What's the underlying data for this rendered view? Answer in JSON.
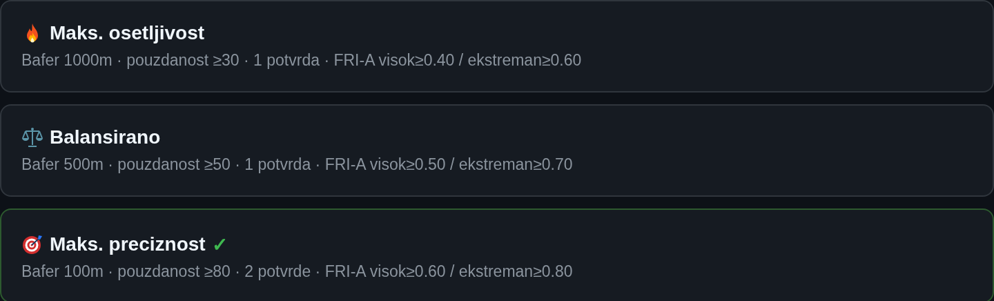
{
  "presets": [
    {
      "kind": "fire",
      "title": "Maks. osetljivost",
      "details": "Bafer 1000m · pouzdanost ≥30 · 1 potvrda · FRI-A visok≥0.40 / ekstreman≥0.60",
      "selected": false
    },
    {
      "kind": "scales",
      "title": "Balansirano",
      "details": "Bafer 500m · pouzdanost ≥50 · 1 potvrda · FRI-A visok≥0.50 / ekstreman≥0.70",
      "selected": false
    },
    {
      "kind": "target",
      "title": "Maks. preciznost",
      "check_mark": "✓",
      "details": "Bafer 100m · pouzdanost ≥80 · 2 potvrde · FRI-A visok≥0.60 / ekstreman≥0.80",
      "selected": true
    }
  ]
}
